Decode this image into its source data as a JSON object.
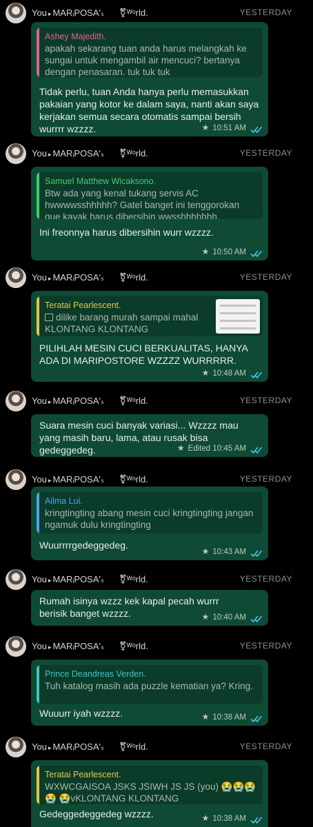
{
  "colors": {
    "background": "#000000",
    "bubble": "#0e4a34",
    "quote": "#0b3b29",
    "tick": "#53bdeb"
  },
  "header": {
    "sender": "You",
    "chat_name": "MARᵢPOSA'ₛ",
    "world": "⚧ᵂᵒrld.",
    "day": "YESTERDAY"
  },
  "posts": [
    {
      "quote_name": "Ashey Majedith.",
      "quote_color": "#e2618a",
      "quote_text": "apakah sekarang tuan anda harus melangkah ke sungai untuk mengambil air mencuci? bertanya dengan penasaran. tuk tuk tuk",
      "text": "Tidak perlu, tuan Anda hanya perlu memasukkan pakaian yang kotor ke dalam saya, nanti akan saya kerjakan semua secara otomatis sampai bersih wurrrr wzzzz.",
      "time": "10:51 AM",
      "edited": ""
    },
    {
      "quote_name": "Samuel Matthew Wicaksono.",
      "quote_color": "#3ecf6b",
      "quote_text": "Btw ada yang kenal tukang servis AC hwwwwsshhhhh? Gatel banget ini tenggorokan gue kayak harus dibersihin wwsshhhhhhh.",
      "text": "Ini freonnya harus dibersihin wurr wzzzz.",
      "time": "10:50 AM",
      "edited": ""
    },
    {
      "quote_name": "Teratai Pearlescent.",
      "quote_color": "#e8c547",
      "quote_text": "dilike barang murah sampai mahal KLONTANG KLONTANG",
      "text": "PILIHLAH MESIN CUCI BERKUALITAS, HANYA ADA DI MARIPOSTORE WZZZZ WURRRRR.",
      "time": "10:48 AM",
      "edited": ""
    },
    {
      "quote_name": "",
      "quote_color": "",
      "quote_text": "",
      "text": "Suara mesin cuci banyak variasi... Wzzzz mau yang masih baru, lama, atau rusak bisa gedeggedeg.",
      "time": "10:45 AM",
      "edited": "Edited"
    },
    {
      "quote_name": "Ailma Lui.",
      "quote_color": "#4aa3f0",
      "quote_text": "kringtingting abang mesin cuci kringtingting jangan ngamuk dulu kringtingting",
      "text": "Wuurrrrgedeggedeg.",
      "time": "10:43 AM",
      "edited": ""
    },
    {
      "quote_name": "",
      "quote_color": "",
      "quote_text": "",
      "text": "Rumah isinya wzzz kek kapal pecah wurrr berisik banget wzzzz.",
      "time": "10:40 AM",
      "edited": ""
    },
    {
      "quote_name": "Prince Deandreas Verden.",
      "quote_color": "#42c3c0",
      "quote_text": "Tuh katalog masih ada puzzle kematian ya? Kring.",
      "text": "Wuuurr iyah wzzzz.",
      "time": "10:38 AM",
      "edited": ""
    },
    {
      "quote_name": "Teratai Pearlescent.",
      "quote_color": "#e8c547",
      "quote_text": "WXWCGAISOA JSKS JSIWH JS JS (you) 😭😭😭😭 😭vKLONTANG KLONTANG",
      "text": "Gedeggedeggedeg wzzzz.",
      "time": "10:38 AM",
      "edited": ""
    }
  ]
}
